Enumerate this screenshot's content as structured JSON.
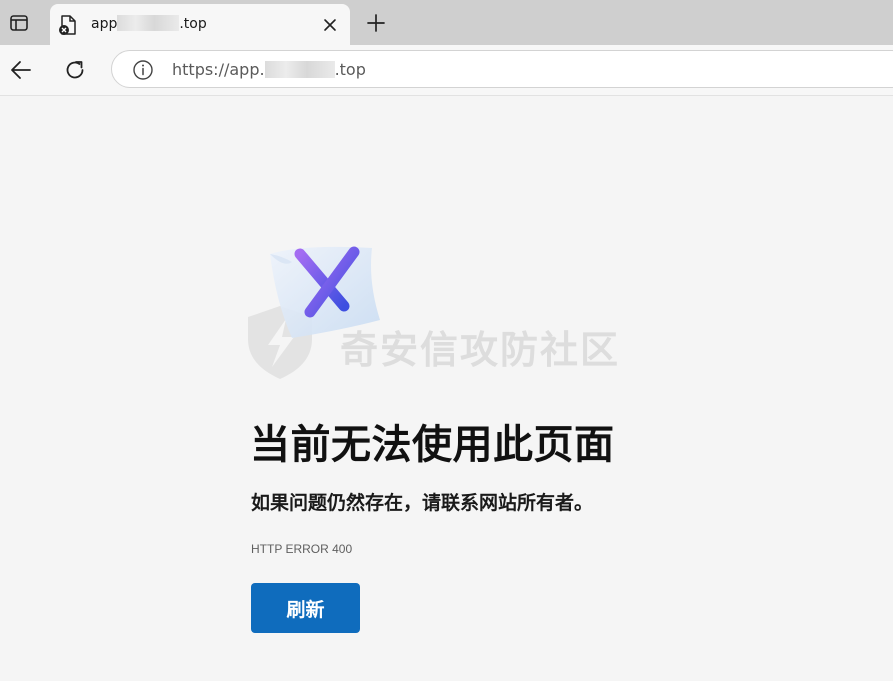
{
  "browser": {
    "tab": {
      "title_prefix": "app",
      "title_suffix": ".top",
      "favicon": "broken-page-icon",
      "close_icon": "close-icon"
    },
    "new_tab_icon": "plus-icon",
    "tab_actions_icon": "tab-actions-icon",
    "toolbar": {
      "back_icon": "back-arrow-icon",
      "reload_icon": "reload-icon"
    },
    "address": {
      "info_icon": "info-icon",
      "url_prefix": "https://app.",
      "url_suffix": ".top"
    }
  },
  "page": {
    "illustration": "error-x-illustration",
    "watermark_text": "奇安信攻防社区",
    "heading": "当前无法使用此页面",
    "message": "如果问题仍然存在，请联系网站所有者。",
    "error_code": "HTTP ERROR 400",
    "refresh_label": "刷新"
  },
  "colors": {
    "accent": "#0f6cbd",
    "background": "#f5f5f5",
    "tabbar": "#cfcfcf"
  }
}
